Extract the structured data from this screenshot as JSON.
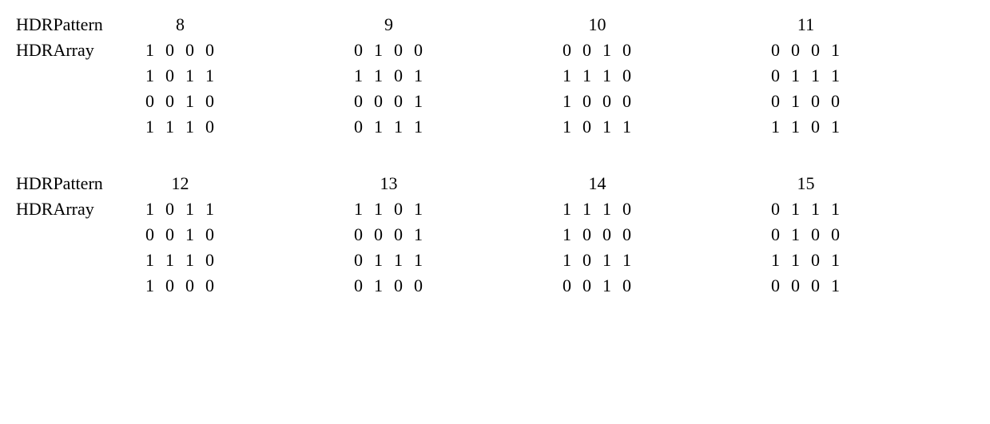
{
  "labels": {
    "pattern": "HDRPattern",
    "array": "HDRArray"
  },
  "sections": [
    {
      "patterns": [
        "8",
        "9",
        "10",
        "11"
      ],
      "arrays": [
        [
          [
            "1",
            "0",
            "0",
            "0"
          ],
          [
            "1",
            "0",
            "1",
            "1"
          ],
          [
            "0",
            "0",
            "1",
            "0"
          ],
          [
            "1",
            "1",
            "1",
            "0"
          ]
        ],
        [
          [
            "0",
            "1",
            "0",
            "0"
          ],
          [
            "1",
            "1",
            "0",
            "1"
          ],
          [
            "0",
            "0",
            "0",
            "1"
          ],
          [
            "0",
            "1",
            "1",
            "1"
          ]
        ],
        [
          [
            "0",
            "0",
            "1",
            "0"
          ],
          [
            "1",
            "1",
            "1",
            "0"
          ],
          [
            "1",
            "0",
            "0",
            "0"
          ],
          [
            "1",
            "0",
            "1",
            "1"
          ]
        ],
        [
          [
            "0",
            "0",
            "0",
            "1"
          ],
          [
            "0",
            "1",
            "1",
            "1"
          ],
          [
            "0",
            "1",
            "0",
            "0"
          ],
          [
            "1",
            "1",
            "0",
            "1"
          ]
        ]
      ]
    },
    {
      "patterns": [
        "12",
        "13",
        "14",
        "15"
      ],
      "arrays": [
        [
          [
            "1",
            "0",
            "1",
            "1"
          ],
          [
            "0",
            "0",
            "1",
            "0"
          ],
          [
            "1",
            "1",
            "1",
            "0"
          ],
          [
            "1",
            "0",
            "0",
            "0"
          ]
        ],
        [
          [
            "1",
            "1",
            "0",
            "1"
          ],
          [
            "0",
            "0",
            "0",
            "1"
          ],
          [
            "0",
            "1",
            "1",
            "1"
          ],
          [
            "0",
            "1",
            "0",
            "0"
          ]
        ],
        [
          [
            "1",
            "1",
            "1",
            "0"
          ],
          [
            "1",
            "0",
            "0",
            "0"
          ],
          [
            "1",
            "0",
            "1",
            "1"
          ],
          [
            "0",
            "0",
            "1",
            "0"
          ]
        ],
        [
          [
            "0",
            "1",
            "1",
            "1"
          ],
          [
            "0",
            "1",
            "0",
            "0"
          ],
          [
            "1",
            "1",
            "0",
            "1"
          ],
          [
            "0",
            "0",
            "0",
            "1"
          ]
        ]
      ]
    }
  ]
}
